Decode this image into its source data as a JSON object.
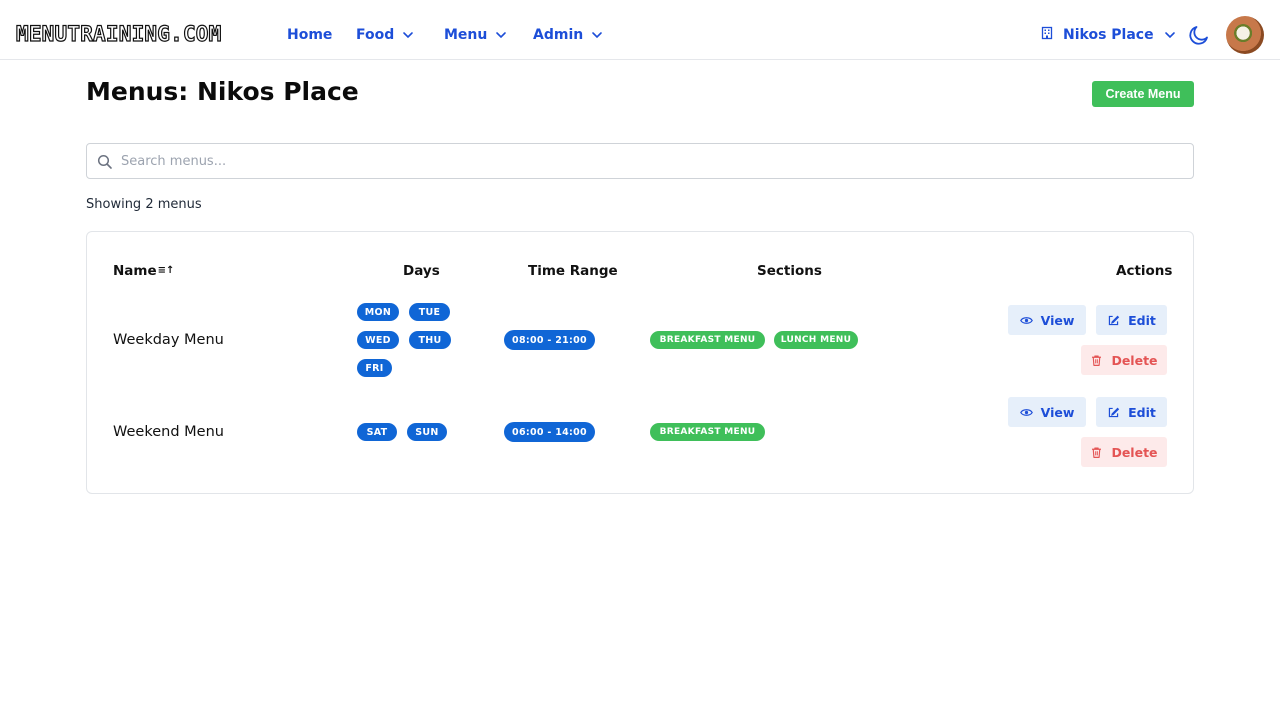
{
  "brand": {
    "logo_text": "MENUTRAINING.COM"
  },
  "nav": {
    "home": "Home",
    "food": "Food",
    "menu": "Menu",
    "admin": "Admin"
  },
  "place_switcher": {
    "label": "Nikos Place"
  },
  "page": {
    "title": "Menus: Nikos Place",
    "create_button": "Create Menu"
  },
  "search": {
    "placeholder": "Search menus...",
    "value": ""
  },
  "results": {
    "count_text": "Showing 2 menus"
  },
  "table": {
    "headers": {
      "name": "Name",
      "sort_glyph": "≡↑",
      "days": "Days",
      "time_range": "Time Range",
      "sections": "Sections",
      "actions": "Actions"
    },
    "rows": [
      {
        "name": "Weekday Menu",
        "days": [
          "MON",
          "TUE",
          "WED",
          "THU",
          "FRI"
        ],
        "time_range": "08:00 - 21:00",
        "sections": [
          "BREAKFAST MENU",
          "LUNCH MENU"
        ],
        "actions": {
          "view": "View",
          "edit": "Edit",
          "delete": "Delete"
        }
      },
      {
        "name": "Weekend Menu",
        "days": [
          "SAT",
          "SUN"
        ],
        "time_range": "06:00 - 14:00",
        "sections": [
          "BREAKFAST MENU"
        ],
        "actions": {
          "view": "View",
          "edit": "Edit",
          "delete": "Delete"
        }
      }
    ]
  },
  "colors": {
    "accent_blue": "#1d4ed8",
    "pill_blue": "#1066d6",
    "green": "#3fbf5a",
    "danger": "#e45454"
  },
  "icons": {
    "chevron": "chevron-down-icon",
    "building": "building-icon",
    "moon": "moon-icon",
    "search": "search-icon",
    "eye": "eye-icon",
    "edit": "edit-icon",
    "trash": "trash-icon"
  }
}
